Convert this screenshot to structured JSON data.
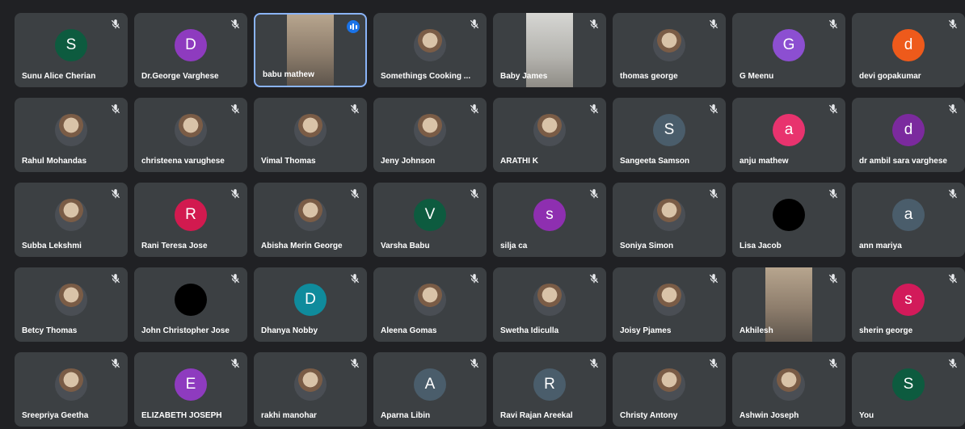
{
  "participants": [
    {
      "name": "Sunu Alice Cherian",
      "initial": "S",
      "color": "#0d5b3f",
      "type": "letter",
      "icon": "mic-off-icon"
    },
    {
      "name": "Dr.George Varghese",
      "initial": "D",
      "color": "#8e3bbf",
      "type": "letter",
      "icon": "mic-off-icon"
    },
    {
      "name": "babu mathew",
      "initial": "",
      "color": "",
      "type": "video",
      "icon": "speaking-indicator-icon"
    },
    {
      "name": "Somethings Cooking ...",
      "initial": "",
      "color": "",
      "type": "photo",
      "icon": "mic-off-icon"
    },
    {
      "name": "Baby James",
      "initial": "",
      "color": "",
      "type": "video-light",
      "icon": "mic-off-icon"
    },
    {
      "name": "thomas george",
      "initial": "",
      "color": "",
      "type": "photo",
      "icon": "mic-off-icon"
    },
    {
      "name": "G Meenu",
      "initial": "G",
      "color": "#8c4fd1",
      "type": "letter",
      "icon": "mic-off-icon"
    },
    {
      "name": "devi gopakumar",
      "initial": "d",
      "color": "#ee5a1b",
      "type": "letter",
      "icon": "mic-off-icon"
    },
    {
      "name": "Rahul Mohandas",
      "initial": "",
      "color": "",
      "type": "photo",
      "icon": "mic-off-icon"
    },
    {
      "name": "christeena varughese",
      "initial": "",
      "color": "",
      "type": "photo",
      "icon": "mic-off-icon"
    },
    {
      "name": "Vimal Thomas",
      "initial": "",
      "color": "",
      "type": "photo",
      "icon": "mic-off-icon"
    },
    {
      "name": "Jeny Johnson",
      "initial": "",
      "color": "",
      "type": "photo",
      "icon": "mic-off-icon"
    },
    {
      "name": "ARATHI K",
      "initial": "",
      "color": "",
      "type": "photo",
      "icon": "mic-off-icon"
    },
    {
      "name": "Sangeeta Samson",
      "initial": "S",
      "color": "#4a5d6b",
      "type": "letter",
      "icon": "mic-off-icon"
    },
    {
      "name": "anju mathew",
      "initial": "a",
      "color": "#e8336e",
      "type": "letter",
      "icon": "mic-off-icon"
    },
    {
      "name": "dr ambil sara varghese",
      "initial": "d",
      "color": "#7b2a9e",
      "type": "letter",
      "icon": "mic-off-icon"
    },
    {
      "name": "Subba Lekshmi",
      "initial": "",
      "color": "",
      "type": "photo",
      "icon": "mic-off-icon"
    },
    {
      "name": "Rani Teresa Jose",
      "initial": "R",
      "color": "#d21a4f",
      "type": "letter",
      "icon": "mic-off-icon"
    },
    {
      "name": "Abisha Merin George",
      "initial": "",
      "color": "",
      "type": "photo",
      "icon": "mic-off-icon"
    },
    {
      "name": "Varsha Babu",
      "initial": "V",
      "color": "#0d5b3f",
      "type": "letter",
      "icon": "mic-off-icon"
    },
    {
      "name": "silja ca",
      "initial": "s",
      "color": "#8e2fb0",
      "type": "letter",
      "icon": "mic-off-icon"
    },
    {
      "name": "Soniya Simon",
      "initial": "",
      "color": "",
      "type": "photo",
      "icon": "mic-off-icon"
    },
    {
      "name": "Lisa Jacob",
      "initial": "",
      "color": "#000000",
      "type": "letter",
      "icon": "mic-off-icon"
    },
    {
      "name": "ann mariya",
      "initial": "a",
      "color": "#4a5d6b",
      "type": "letter",
      "icon": "mic-off-icon"
    },
    {
      "name": "Betcy Thomas",
      "initial": "",
      "color": "",
      "type": "photo",
      "icon": "mic-off-icon"
    },
    {
      "name": "John Christopher Jose",
      "initial": "",
      "color": "#000000",
      "type": "letter",
      "icon": "mic-off-icon"
    },
    {
      "name": "Dhanya Nobby",
      "initial": "D",
      "color": "#0f8b9c",
      "type": "letter",
      "icon": "mic-off-icon"
    },
    {
      "name": "Aleena Gomas",
      "initial": "",
      "color": "",
      "type": "photo",
      "icon": "mic-off-icon"
    },
    {
      "name": "Swetha Idiculla",
      "initial": "",
      "color": "",
      "type": "photo",
      "icon": "mic-off-icon"
    },
    {
      "name": "Joisy Pjames",
      "initial": "",
      "color": "",
      "type": "photo",
      "icon": "mic-off-icon"
    },
    {
      "name": "Akhilesh",
      "initial": "",
      "color": "",
      "type": "video",
      "icon": "mic-off-icon"
    },
    {
      "name": "sherin george",
      "initial": "s",
      "color": "#d21a5a",
      "type": "letter",
      "icon": "mic-off-icon"
    },
    {
      "name": "Sreepriya Geetha",
      "initial": "",
      "color": "",
      "type": "photo",
      "icon": "mic-off-icon"
    },
    {
      "name": "ELIZABETH JOSEPH",
      "initial": "E",
      "color": "#8e3bbf",
      "type": "letter",
      "icon": "mic-off-icon"
    },
    {
      "name": "rakhi manohar",
      "initial": "",
      "color": "",
      "type": "photo",
      "icon": "mic-off-icon"
    },
    {
      "name": "Aparna Libin",
      "initial": "A",
      "color": "#4a5d6b",
      "type": "letter",
      "icon": "mic-off-icon"
    },
    {
      "name": "Ravi Rajan Areekal",
      "initial": "R",
      "color": "#4a5d6b",
      "type": "letter",
      "icon": "mic-off-icon"
    },
    {
      "name": "Christy Antony",
      "initial": "",
      "color": "",
      "type": "photo",
      "icon": "mic-off-icon"
    },
    {
      "name": "Ashwin Joseph",
      "initial": "",
      "color": "",
      "type": "photo",
      "icon": "mic-off-icon"
    },
    {
      "name": "You",
      "initial": "S",
      "color": "#0d5b3f",
      "type": "letter",
      "icon": "mic-off-icon"
    }
  ]
}
